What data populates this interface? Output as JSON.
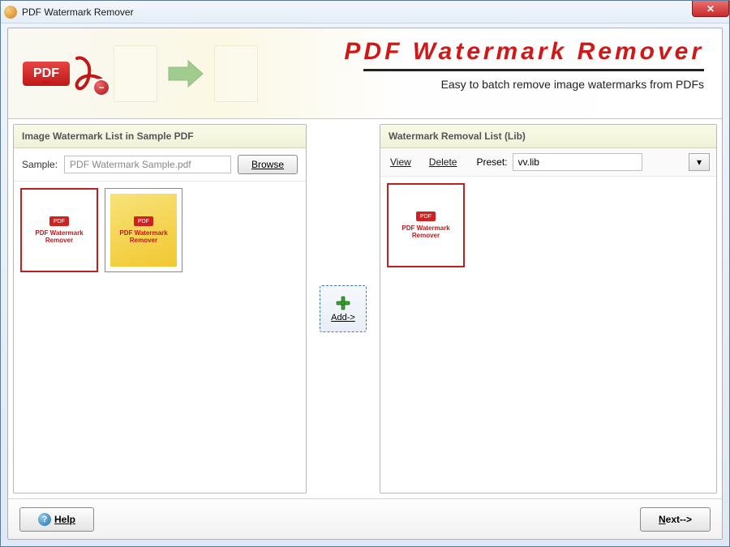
{
  "window": {
    "title": "PDF Watermark Remover",
    "close_glyph": "✕"
  },
  "banner": {
    "pdf_badge": "PDF",
    "title": "PDF   Watermark   Remover",
    "subtitle": "Easy to batch remove image watermarks from PDFs"
  },
  "left_panel": {
    "header": "Image Watermark List  in Sample PDF",
    "sample_label": "Sample:",
    "sample_value": "PDF Watermark Sample.pdf",
    "browse_label": "Browse",
    "thumbs": [
      {
        "variant": "white",
        "mini_text": "PDF Watermark Remover",
        "selected": true
      },
      {
        "variant": "yellow",
        "mini_text": "PDF Watermark Remover",
        "selected": false
      }
    ]
  },
  "mid": {
    "add_label": "Add->"
  },
  "right_panel": {
    "header": "Watermark Removal List (Lib)",
    "view_label": "View",
    "delete_label": "Delete",
    "preset_label": "Preset:",
    "preset_value": "vv.lib",
    "dropdown_glyph": "▾",
    "thumbs": [
      {
        "variant": "white",
        "mini_text": "PDF Watermark Remover",
        "selected": true
      }
    ]
  },
  "footer": {
    "help_label": "Help",
    "next_label": "Next-->"
  }
}
